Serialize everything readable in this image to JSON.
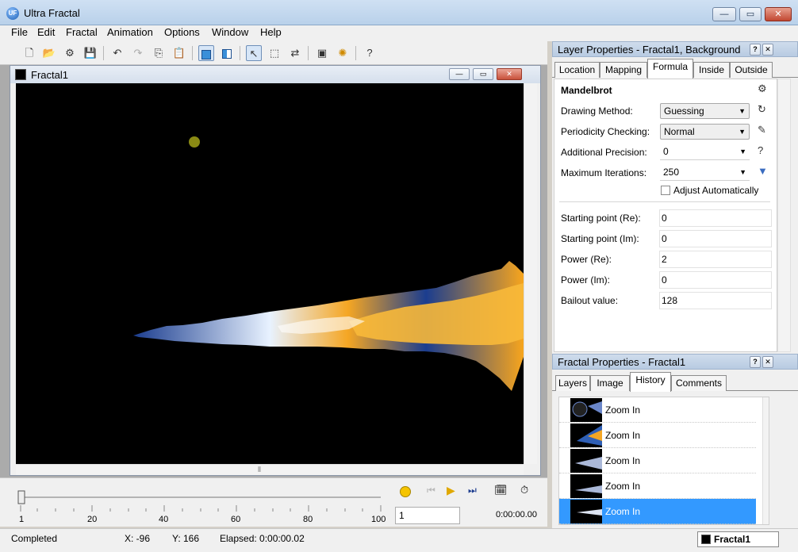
{
  "window": {
    "title": "Ultra Fractal"
  },
  "menu": [
    "File",
    "Edit",
    "Fractal",
    "Animation",
    "Options",
    "Window",
    "Help"
  ],
  "toolbar": {
    "buttons": [
      "new-icon",
      "open-icon",
      "browse-icon",
      "save-icon",
      "undo-icon",
      "redo-icon",
      "copy-icon",
      "paste-icon",
      "full-screen-icon",
      "split-icon",
      "select-icon",
      "zoom-box-icon",
      "switch-icon",
      "render-icon",
      "options-icon",
      "help-icon"
    ],
    "help_label": "?"
  },
  "fractal_window": {
    "title": "Fractal1"
  },
  "timeline": {
    "ticks": [
      "1",
      "20",
      "40",
      "60",
      "80",
      "100"
    ],
    "frame_value": "1",
    "elapsed": "0:00:00.00"
  },
  "status": {
    "state": "Completed",
    "x": "X: -96",
    "y": "Y: 166",
    "elapsed": "Elapsed: 0:00:00.02",
    "active_tab": "Fractal1"
  },
  "layer_panel": {
    "title": "Layer Properties - Fractal1, Background",
    "tabs": [
      "Location",
      "Mapping",
      "Formula",
      "Inside",
      "Outside"
    ],
    "active_tab": "Formula",
    "formula_name": "Mandelbrot",
    "drawing_method": {
      "label": "Drawing Method:",
      "value": "Guessing"
    },
    "periodicity": {
      "label": "Periodicity Checking:",
      "value": "Normal"
    },
    "precision": {
      "label": "Additional Precision:",
      "value": "0"
    },
    "iterations": {
      "label": "Maximum Iterations:",
      "value": "250"
    },
    "adjust_auto": {
      "label": "Adjust Automatically",
      "checked": false
    },
    "params": [
      {
        "label": "Starting point (Re):",
        "value": "0"
      },
      {
        "label": "Starting point (Im):",
        "value": "0"
      },
      {
        "label": "Power (Re):",
        "value": "2"
      },
      {
        "label": "Power (Im):",
        "value": "0"
      },
      {
        "label": "Bailout value:",
        "value": "128"
      }
    ]
  },
  "fractal_panel": {
    "title": "Fractal Properties - Fractal1",
    "tabs": [
      "Layers",
      "Image",
      "History",
      "Comments"
    ],
    "active_tab": "History",
    "history": [
      "Zoom In",
      "Zoom In",
      "Zoom In",
      "Zoom In",
      "Zoom In"
    ],
    "selected_index": 4
  },
  "colors": {
    "fractal_dark": "#000000",
    "fractal_orange": "#f5a623",
    "fractal_blue": "#1b3d8f",
    "selection": "#3399ff"
  }
}
